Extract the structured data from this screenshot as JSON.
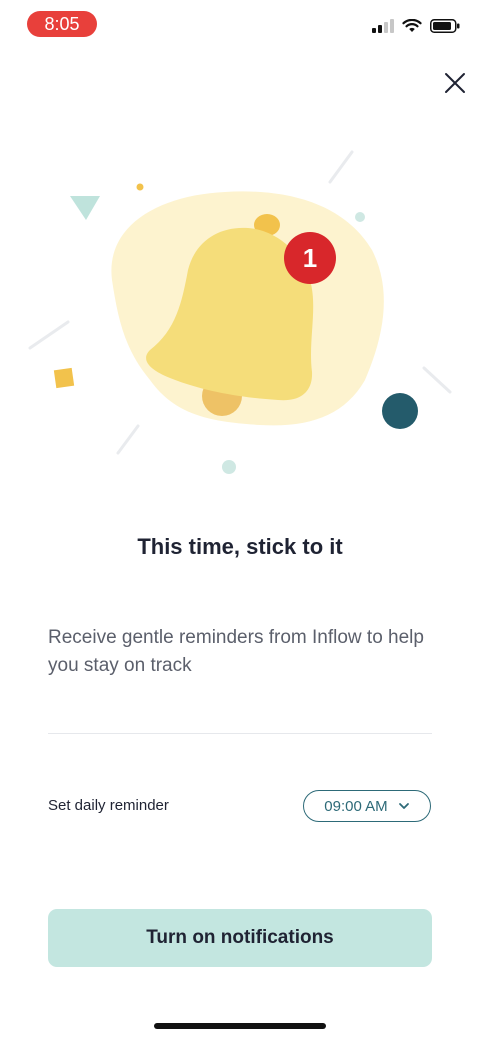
{
  "status_bar": {
    "time": "8:05"
  },
  "illustration": {
    "badge_count": "1"
  },
  "content": {
    "title": "This time, stick to it",
    "subtitle": "Receive gentle reminders from Inflow to help you stay on track"
  },
  "reminder": {
    "label": "Set daily reminder",
    "time_value": "09:00 AM"
  },
  "cta": {
    "label": "Turn on notifications"
  },
  "colors": {
    "accent": "#2d6a78",
    "button_bg": "#c3e6e0",
    "badge": "#d8272b",
    "bell": "#f5dd7a",
    "time_pill": "#e8403b"
  }
}
